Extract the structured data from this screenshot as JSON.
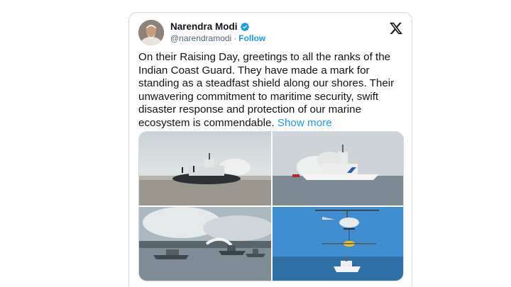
{
  "author": {
    "name": "Narendra Modi",
    "handle": "@narendramodi",
    "separator": "·",
    "follow_label": "Follow"
  },
  "tweet": {
    "text": "On their Raising Day, greetings to all the ranks of the Indian Coast Guard. They have made a mark for standing as a steadfast shield along our shores. Their unwavering commitment to maritime security, swift disaster response and protection of our marine ecosystem is commendable.",
    "show_more": "Show more"
  },
  "icons": {
    "verified": "verified-badge-icon",
    "platform": "x-logo-icon"
  },
  "colors": {
    "accent": "#1d9bf0",
    "text": "#0f1419",
    "muted": "#536471",
    "border": "#cfd9de"
  }
}
